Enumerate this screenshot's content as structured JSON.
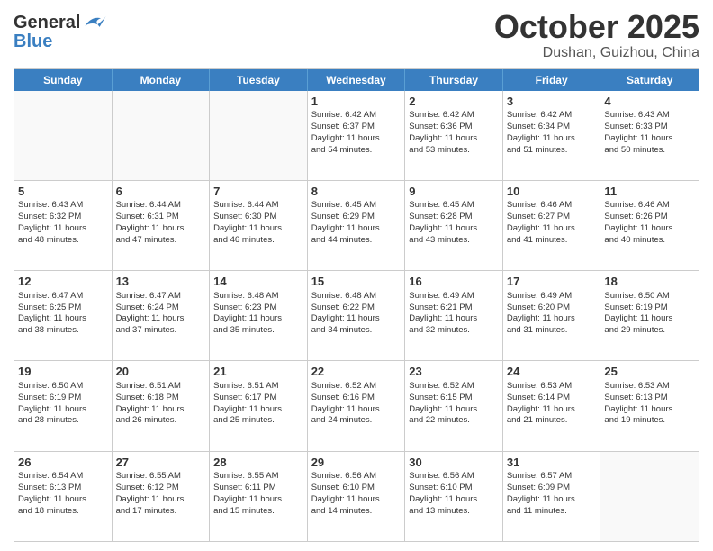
{
  "header": {
    "logo_line1": "General",
    "logo_line2": "Blue",
    "month": "October 2025",
    "location": "Dushan, Guizhou, China"
  },
  "weekdays": [
    "Sunday",
    "Monday",
    "Tuesday",
    "Wednesday",
    "Thursday",
    "Friday",
    "Saturday"
  ],
  "rows": [
    [
      {
        "day": "",
        "info": "",
        "empty": true
      },
      {
        "day": "",
        "info": "",
        "empty": true
      },
      {
        "day": "",
        "info": "",
        "empty": true
      },
      {
        "day": "1",
        "info": "Sunrise: 6:42 AM\nSunset: 6:37 PM\nDaylight: 11 hours\nand 54 minutes.",
        "empty": false
      },
      {
        "day": "2",
        "info": "Sunrise: 6:42 AM\nSunset: 6:36 PM\nDaylight: 11 hours\nand 53 minutes.",
        "empty": false
      },
      {
        "day": "3",
        "info": "Sunrise: 6:42 AM\nSunset: 6:34 PM\nDaylight: 11 hours\nand 51 minutes.",
        "empty": false
      },
      {
        "day": "4",
        "info": "Sunrise: 6:43 AM\nSunset: 6:33 PM\nDaylight: 11 hours\nand 50 minutes.",
        "empty": false
      }
    ],
    [
      {
        "day": "5",
        "info": "Sunrise: 6:43 AM\nSunset: 6:32 PM\nDaylight: 11 hours\nand 48 minutes.",
        "empty": false
      },
      {
        "day": "6",
        "info": "Sunrise: 6:44 AM\nSunset: 6:31 PM\nDaylight: 11 hours\nand 47 minutes.",
        "empty": false
      },
      {
        "day": "7",
        "info": "Sunrise: 6:44 AM\nSunset: 6:30 PM\nDaylight: 11 hours\nand 46 minutes.",
        "empty": false
      },
      {
        "day": "8",
        "info": "Sunrise: 6:45 AM\nSunset: 6:29 PM\nDaylight: 11 hours\nand 44 minutes.",
        "empty": false
      },
      {
        "day": "9",
        "info": "Sunrise: 6:45 AM\nSunset: 6:28 PM\nDaylight: 11 hours\nand 43 minutes.",
        "empty": false
      },
      {
        "day": "10",
        "info": "Sunrise: 6:46 AM\nSunset: 6:27 PM\nDaylight: 11 hours\nand 41 minutes.",
        "empty": false
      },
      {
        "day": "11",
        "info": "Sunrise: 6:46 AM\nSunset: 6:26 PM\nDaylight: 11 hours\nand 40 minutes.",
        "empty": false
      }
    ],
    [
      {
        "day": "12",
        "info": "Sunrise: 6:47 AM\nSunset: 6:25 PM\nDaylight: 11 hours\nand 38 minutes.",
        "empty": false
      },
      {
        "day": "13",
        "info": "Sunrise: 6:47 AM\nSunset: 6:24 PM\nDaylight: 11 hours\nand 37 minutes.",
        "empty": false
      },
      {
        "day": "14",
        "info": "Sunrise: 6:48 AM\nSunset: 6:23 PM\nDaylight: 11 hours\nand 35 minutes.",
        "empty": false
      },
      {
        "day": "15",
        "info": "Sunrise: 6:48 AM\nSunset: 6:22 PM\nDaylight: 11 hours\nand 34 minutes.",
        "empty": false
      },
      {
        "day": "16",
        "info": "Sunrise: 6:49 AM\nSunset: 6:21 PM\nDaylight: 11 hours\nand 32 minutes.",
        "empty": false
      },
      {
        "day": "17",
        "info": "Sunrise: 6:49 AM\nSunset: 6:20 PM\nDaylight: 11 hours\nand 31 minutes.",
        "empty": false
      },
      {
        "day": "18",
        "info": "Sunrise: 6:50 AM\nSunset: 6:19 PM\nDaylight: 11 hours\nand 29 minutes.",
        "empty": false
      }
    ],
    [
      {
        "day": "19",
        "info": "Sunrise: 6:50 AM\nSunset: 6:19 PM\nDaylight: 11 hours\nand 28 minutes.",
        "empty": false
      },
      {
        "day": "20",
        "info": "Sunrise: 6:51 AM\nSunset: 6:18 PM\nDaylight: 11 hours\nand 26 minutes.",
        "empty": false
      },
      {
        "day": "21",
        "info": "Sunrise: 6:51 AM\nSunset: 6:17 PM\nDaylight: 11 hours\nand 25 minutes.",
        "empty": false
      },
      {
        "day": "22",
        "info": "Sunrise: 6:52 AM\nSunset: 6:16 PM\nDaylight: 11 hours\nand 24 minutes.",
        "empty": false
      },
      {
        "day": "23",
        "info": "Sunrise: 6:52 AM\nSunset: 6:15 PM\nDaylight: 11 hours\nand 22 minutes.",
        "empty": false
      },
      {
        "day": "24",
        "info": "Sunrise: 6:53 AM\nSunset: 6:14 PM\nDaylight: 11 hours\nand 21 minutes.",
        "empty": false
      },
      {
        "day": "25",
        "info": "Sunrise: 6:53 AM\nSunset: 6:13 PM\nDaylight: 11 hours\nand 19 minutes.",
        "empty": false
      }
    ],
    [
      {
        "day": "26",
        "info": "Sunrise: 6:54 AM\nSunset: 6:13 PM\nDaylight: 11 hours\nand 18 minutes.",
        "empty": false
      },
      {
        "day": "27",
        "info": "Sunrise: 6:55 AM\nSunset: 6:12 PM\nDaylight: 11 hours\nand 17 minutes.",
        "empty": false
      },
      {
        "day": "28",
        "info": "Sunrise: 6:55 AM\nSunset: 6:11 PM\nDaylight: 11 hours\nand 15 minutes.",
        "empty": false
      },
      {
        "day": "29",
        "info": "Sunrise: 6:56 AM\nSunset: 6:10 PM\nDaylight: 11 hours\nand 14 minutes.",
        "empty": false
      },
      {
        "day": "30",
        "info": "Sunrise: 6:56 AM\nSunset: 6:10 PM\nDaylight: 11 hours\nand 13 minutes.",
        "empty": false
      },
      {
        "day": "31",
        "info": "Sunrise: 6:57 AM\nSunset: 6:09 PM\nDaylight: 11 hours\nand 11 minutes.",
        "empty": false
      },
      {
        "day": "",
        "info": "",
        "empty": true
      }
    ]
  ]
}
